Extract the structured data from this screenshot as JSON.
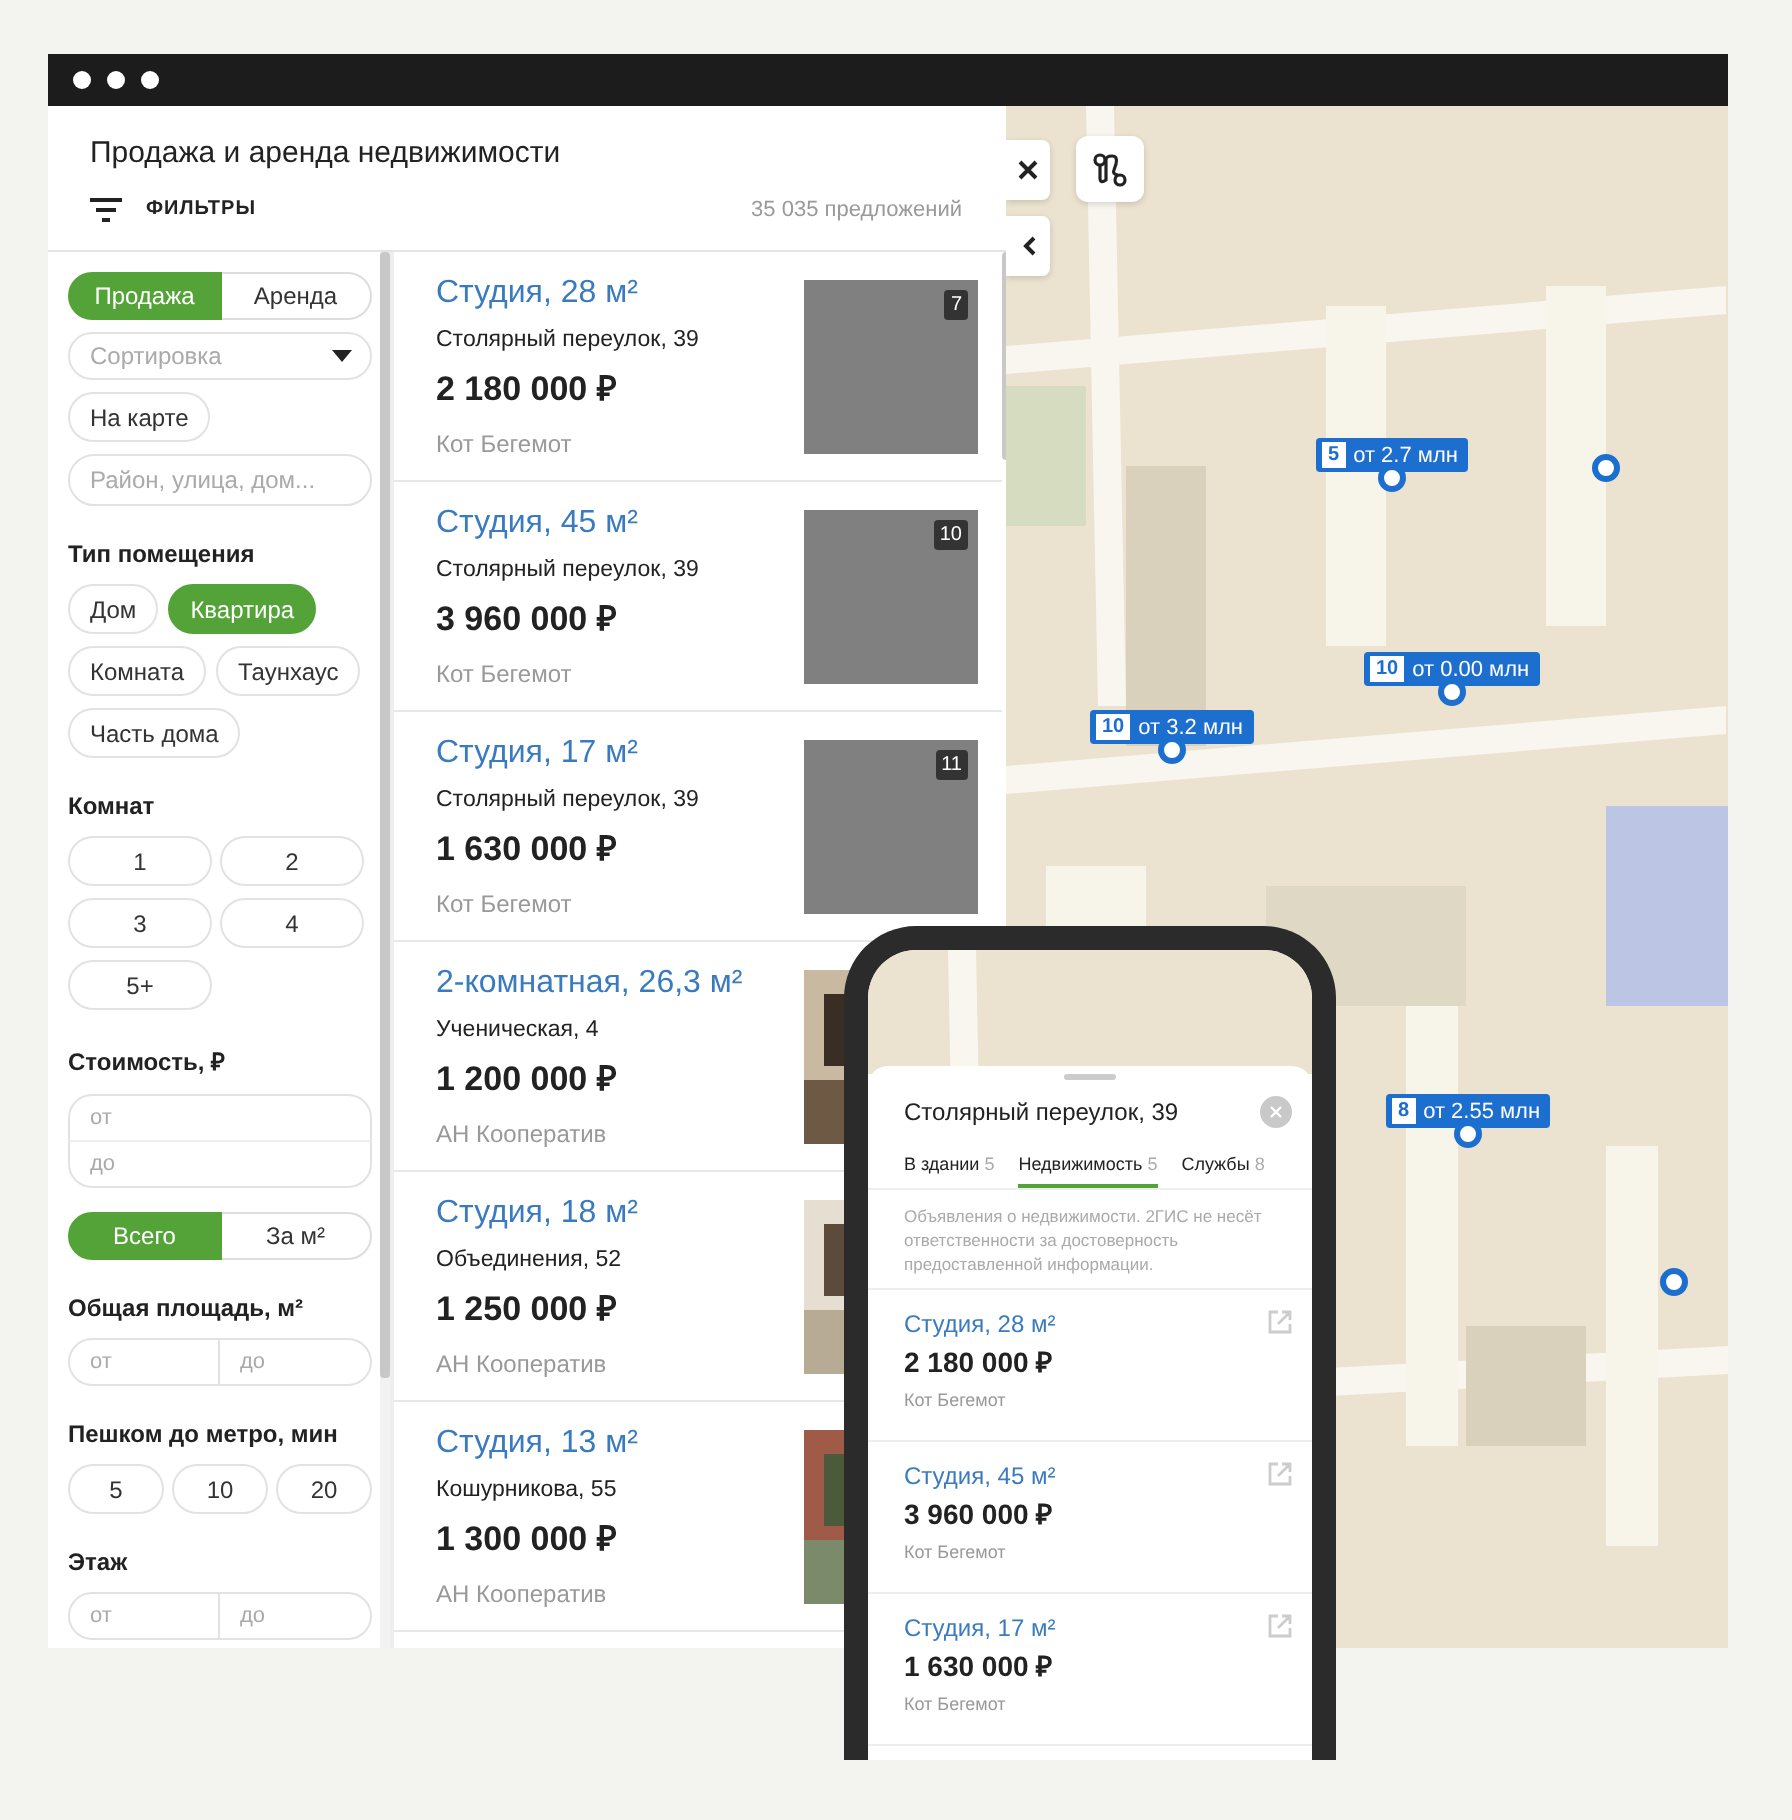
{
  "window": {
    "title": "Продажа и аренда недвижимости"
  },
  "toolbar": {
    "filters_label": "ФИЛЬТРЫ",
    "count": "35 035 предложений"
  },
  "filters": {
    "deal_tabs": [
      {
        "label": "Продажа",
        "selected": true
      },
      {
        "label": "Аренда",
        "selected": false
      }
    ],
    "sort": {
      "placeholder": "Сортировка"
    },
    "on_map": "На карте",
    "search": {
      "placeholder": "Район, улица, дом..."
    },
    "sections": [
      {
        "kind": "chips",
        "title": "Тип помещения",
        "options": [
          {
            "label": "Дом",
            "selected": false
          },
          {
            "label": "Квартира",
            "selected": true
          },
          {
            "label": "Комната",
            "selected": false
          },
          {
            "label": "Таунхаус",
            "selected": false
          },
          {
            "label": "Часть дома",
            "selected": false
          }
        ]
      },
      {
        "kind": "rooms",
        "title": "Комнат",
        "options": [
          {
            "label": "1",
            "selected": false
          },
          {
            "label": "2",
            "selected": false
          },
          {
            "label": "3",
            "selected": false
          },
          {
            "label": "4",
            "selected": false
          },
          {
            "label": "5+",
            "selected": false
          }
        ]
      },
      {
        "kind": "price",
        "title": "Стоимость, ₽",
        "from": {
          "placeholder": "от"
        },
        "to": {
          "placeholder": "до"
        },
        "units": [
          {
            "label": "Всего",
            "selected": true
          },
          {
            "label": "За м²",
            "selected": false
          }
        ]
      },
      {
        "kind": "range",
        "title": "Общая площадь, м²",
        "from": {
          "placeholder": "от"
        },
        "to": {
          "placeholder": "до"
        }
      },
      {
        "kind": "minutes",
        "title": "Пешком до метро, мин",
        "options": [
          {
            "label": "5",
            "selected": false
          },
          {
            "label": "10",
            "selected": false
          },
          {
            "label": "20",
            "selected": false
          }
        ]
      },
      {
        "kind": "range",
        "title": "Этаж",
        "from": {
          "placeholder": "от"
        },
        "to": {
          "placeholder": "до"
        }
      }
    ]
  },
  "listings": [
    {
      "title": "Студия, 28 м²",
      "address": "Столярный переулок, 39",
      "price": "2 180 000 ₽",
      "agent": "Кот Бегемот",
      "image": {
        "kind": "placeholder",
        "count": "7"
      }
    },
    {
      "title": "Студия, 45 м²",
      "address": "Столярный переулок, 39",
      "price": "3 960 000 ₽",
      "agent": "Кот Бегемот",
      "image": {
        "kind": "placeholder",
        "count": "10"
      }
    },
    {
      "title": "Студия, 17 м²",
      "address": "Столярный переулок, 39",
      "price": "1 630 000 ₽",
      "agent": "Кот Бегемот",
      "image": {
        "kind": "placeholder",
        "count": "11"
      }
    },
    {
      "title": "2-комнатная, 26,3 м²",
      "address": "Ученическая, 4",
      "price": "1 200 000 ₽",
      "agent": "АН Кооператив"
    },
    {
      "title": "Студия, 18 м²",
      "address": "Объединения, 52",
      "price": "1 250 000 ₽",
      "agent": "АН Кооператив"
    },
    {
      "title": "Студия, 13 м²",
      "address": "Кошурникова, 55",
      "price": "1 300 000 ₽",
      "agent": "АН Кооператив"
    }
  ],
  "map": {
    "kind": "picture",
    "pins": [
      {
        "count": "5",
        "price": "от 2.7 млн"
      },
      {
        "count": "10",
        "price": "от 0.00 млн"
      },
      {
        "count": "10",
        "price": "от 3.2 млн"
      },
      {
        "count": "8",
        "price": "от 2.55 млн"
      }
    ]
  },
  "phone": {
    "address": "Столярный переулок, 39",
    "tabs": [
      {
        "label": "В здании",
        "count": "5",
        "selected": false
      },
      {
        "label": "Недвижимость",
        "count": "5",
        "selected": true
      },
      {
        "label": "Службы",
        "count": "8",
        "selected": false
      }
    ],
    "notice": "Объявления о недвижимости. 2ГИС не несёт ответственности за достоверность предоставленной информации.",
    "listings": [
      {
        "title": "Студия, 28 м²",
        "price": "2 180 000 ₽",
        "agent": "Кот Бегемот"
      },
      {
        "title": "Студия, 45 м²",
        "price": "3 960 000 ₽",
        "agent": "Кот Бегемот"
      },
      {
        "title": "Студия, 17 м²",
        "price": "1 630 000 ₽",
        "agent": "Кот Бегемот"
      }
    ]
  }
}
